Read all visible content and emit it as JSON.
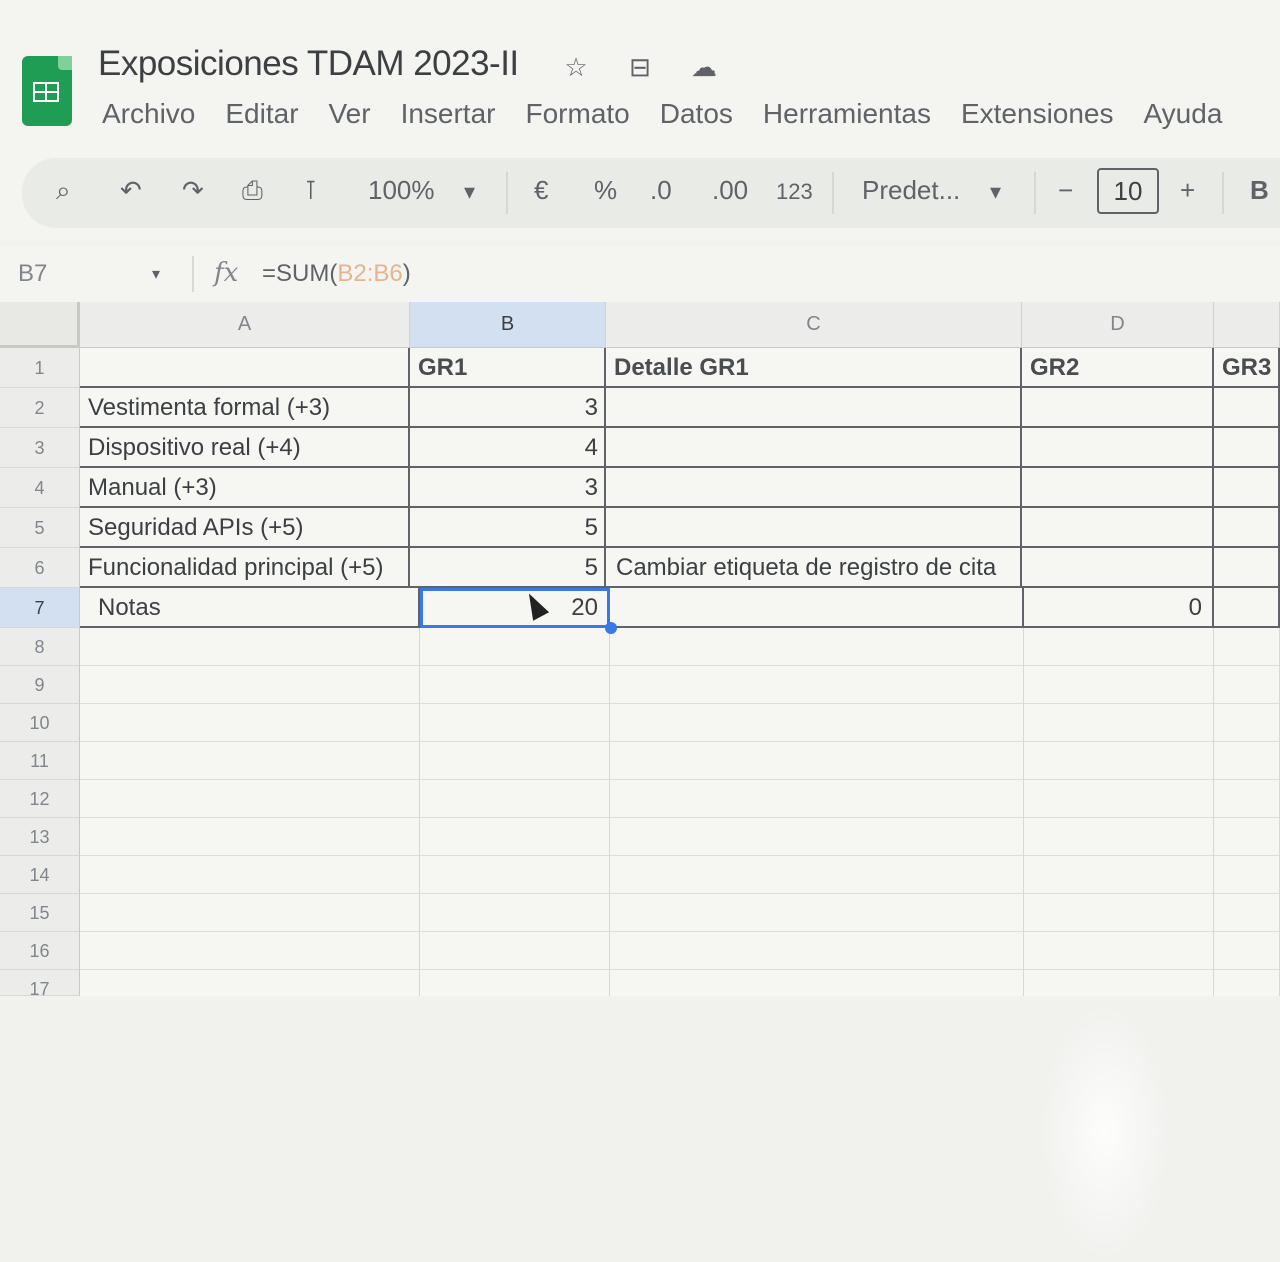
{
  "app": {
    "title": "Exposiciones TDAM 2023-II"
  },
  "title_icons": [
    "star-icon",
    "move-to-folder-icon",
    "cloud-status-icon"
  ],
  "menu": [
    "Archivo",
    "Editar",
    "Ver",
    "Insertar",
    "Formato",
    "Datos",
    "Herramientas",
    "Extensiones",
    "Ayuda"
  ],
  "toolbar": {
    "zoom": "100%",
    "currency": "€",
    "percent": "%",
    "dec_decrease": ".0",
    "dec_increase": ".00",
    "number_format": "123",
    "font": "Predet...",
    "font_size": "10",
    "minus": "−",
    "plus": "+",
    "bold": "B"
  },
  "formula_bar": {
    "cell_ref": "B7",
    "fx": "fx",
    "formula_prefix": "=SUM(",
    "formula_range": "B2:B6",
    "formula_suffix": ")"
  },
  "columns": [
    "A",
    "B",
    "C",
    "D"
  ],
  "rows": [
    "1",
    "2",
    "3",
    "4",
    "5",
    "6",
    "7",
    "8",
    "9",
    "10",
    "11",
    "12",
    "13",
    "14",
    "15",
    "16",
    "17"
  ],
  "sheet": {
    "headers": {
      "b": "GR1",
      "c": "Detalle GR1",
      "d": "GR2",
      "e": "GR3"
    },
    "criteria": [
      {
        "label": "Vestimenta formal (+3)",
        "gr1": "3",
        "detail": ""
      },
      {
        "label": "Dispositivo real (+4)",
        "gr1": "4",
        "detail": ""
      },
      {
        "label": "Manual (+3)",
        "gr1": "3",
        "detail": ""
      },
      {
        "label": "Seguridad APIs (+5)",
        "gr1": "5",
        "detail": ""
      },
      {
        "label": "Funcionalidad principal (+5)",
        "gr1": "5",
        "detail": "Cambiar etiqueta de registro de cita"
      }
    ],
    "totals": {
      "label": "Notas",
      "gr1": "20",
      "gr2": "0"
    }
  },
  "colors": {
    "selection": "#3b78e7",
    "sheets_green": "#1f9d55"
  }
}
